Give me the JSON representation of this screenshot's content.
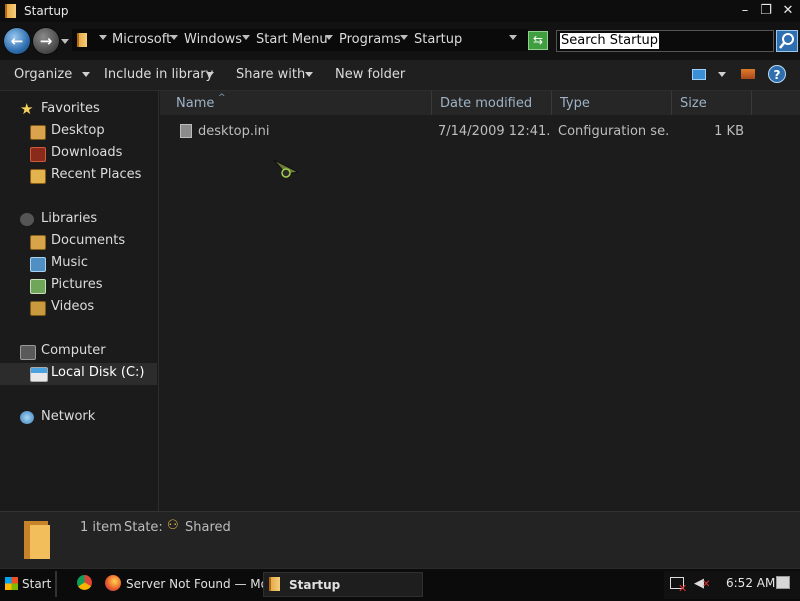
{
  "window": {
    "title": "Startup",
    "buttons": {
      "minimize": "–",
      "maximize": "❐",
      "close": "✕"
    }
  },
  "address": {
    "breadcrumbs": [
      "Microsoft",
      "Windows",
      "Start Menu",
      "Programs",
      "Startup"
    ],
    "search_placeholder": "Search Startup"
  },
  "toolbar": {
    "organize": "Organize",
    "include_in_library": "Include in library",
    "share_with": "Share with",
    "new_folder": "New folder"
  },
  "nav": {
    "favorites_header": "Favorites",
    "favorites": [
      "Desktop",
      "Downloads",
      "Recent Places"
    ],
    "libraries_header": "Libraries",
    "libraries": [
      "Documents",
      "Music",
      "Pictures",
      "Videos"
    ],
    "computer_header": "Computer",
    "computer": [
      "Local Disk (C:)"
    ],
    "network_header": "Network",
    "selected": "Local Disk (C:)"
  },
  "file_list": {
    "columns": [
      "Name",
      "Date modified",
      "Type",
      "Size"
    ],
    "sort_column": "Name",
    "rows": [
      {
        "name": "desktop.ini",
        "date_modified": "7/14/2009 12:41...",
        "type": "Configuration se...",
        "size": "1 KB"
      }
    ]
  },
  "details": {
    "item_count": "1 item",
    "state_label": "State:",
    "state_value": "Shared"
  },
  "taskbar": {
    "start": "Start",
    "tasks": [
      {
        "label": "Server Not Found — Moz...",
        "app": "firefox"
      },
      {
        "label": "Startup",
        "app": "explorer",
        "active": true
      }
    ],
    "clock": "6:52 AM"
  },
  "colors": {
    "accent": "#2f6fb0",
    "folder": "#f0b64a",
    "background": "#1c1c1c"
  }
}
